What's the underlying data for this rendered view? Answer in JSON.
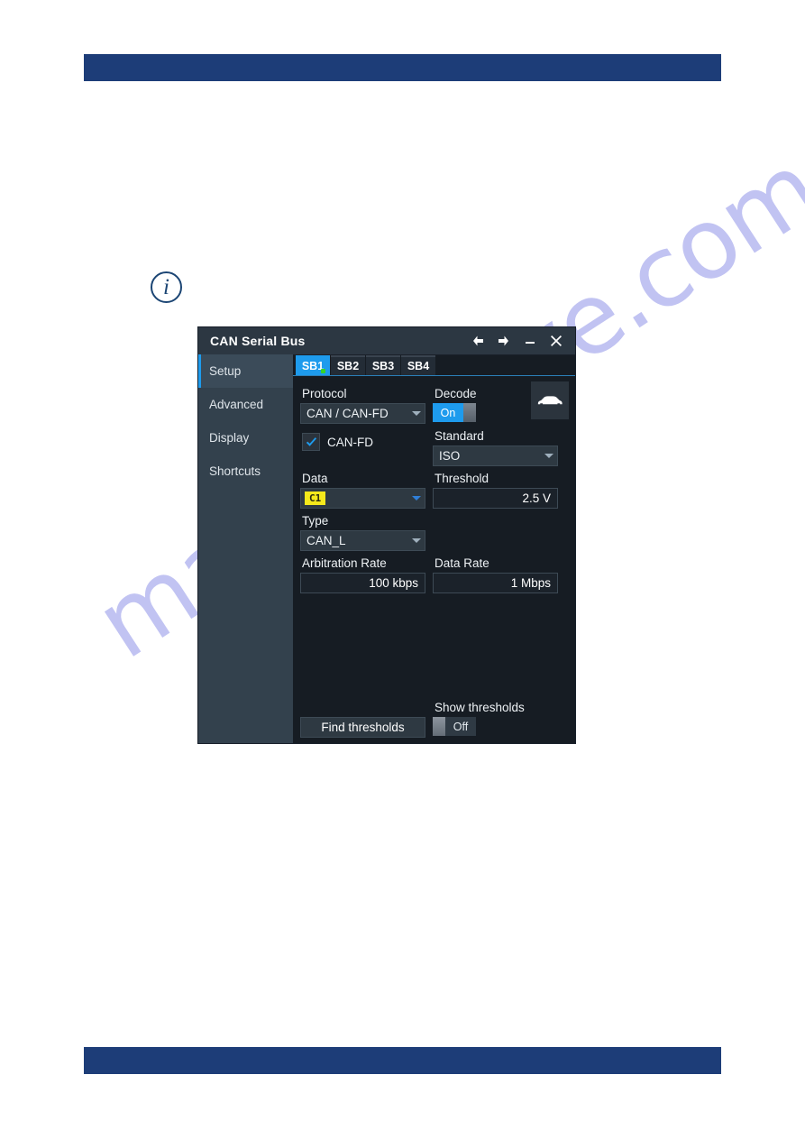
{
  "page": {
    "watermark": "manualshive.com",
    "info_icon": "info-icon",
    "header_bar_color": "#1d3d78",
    "footer_bar_color": "#1d3d78"
  },
  "dialog": {
    "title": "CAN Serial Bus",
    "titlebar_actions": [
      {
        "name": "back-arrow-icon",
        "label": "←"
      },
      {
        "name": "forward-arrow-icon",
        "label": "→"
      },
      {
        "name": "minimize-icon",
        "label": "—"
      },
      {
        "name": "close-icon",
        "label": "✕"
      }
    ],
    "sidebar": {
      "items": [
        {
          "label": "Setup",
          "active": true
        },
        {
          "label": "Advanced",
          "active": false
        },
        {
          "label": "Display",
          "active": false
        },
        {
          "label": "Shortcuts",
          "active": false
        }
      ]
    },
    "tabs": [
      {
        "label": "SB1",
        "active": true,
        "status_dot": "#37d22a"
      },
      {
        "label": "SB2",
        "active": false
      },
      {
        "label": "SB3",
        "active": false
      },
      {
        "label": "SB4",
        "active": false
      }
    ],
    "fields": {
      "protocol": {
        "label": "Protocol",
        "value": "CAN / CAN-FD"
      },
      "decode": {
        "label": "Decode",
        "value": "On",
        "state": "on"
      },
      "standard": {
        "label": "Standard",
        "value": "ISO"
      },
      "can_fd": {
        "label": "CAN-FD",
        "checked": true
      },
      "data": {
        "label": "Data",
        "value": "",
        "badge": "C1"
      },
      "threshold": {
        "label": "Threshold",
        "value": "2.5 V"
      },
      "type": {
        "label": "Type",
        "value": "CAN_L"
      },
      "arbitration_rate": {
        "label": "Arbitration Rate",
        "value": "100 kbps"
      },
      "data_rate": {
        "label": "Data Rate",
        "value": "1 Mbps"
      },
      "show_thresholds": {
        "label": "Show thresholds",
        "value": "Off",
        "state": "off"
      },
      "find_thresholds": {
        "label": "Find thresholds"
      }
    },
    "icons": {
      "car": "car-icon"
    },
    "colors": {
      "accent_blue": "#1e9bed",
      "tab_active": "#1e9bed",
      "channel_yellow": "#f5e81b",
      "status_green": "#37d22a",
      "panel_bg": "#161c23",
      "sidebar_bg": "#33414d",
      "titlebar_bg": "#2c3742"
    }
  }
}
